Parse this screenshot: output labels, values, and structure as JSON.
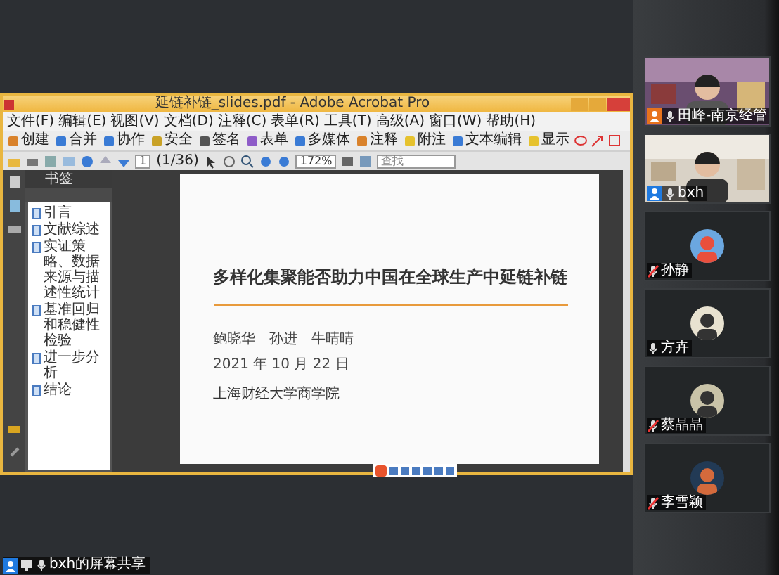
{
  "window": {
    "title": "延链补链_slides.pdf - Adobe Acrobat Pro"
  },
  "menu": [
    "文件(F)",
    "编辑(E)",
    "视图(V)",
    "文档(D)",
    "注释(C)",
    "表单(R)",
    "工具(T)",
    "高级(A)",
    "窗口(W)",
    "帮助(H)"
  ],
  "toolbar": [
    {
      "label": "创建",
      "color": "#d9822b"
    },
    {
      "label": "合并",
      "color": "#3a7bd5"
    },
    {
      "label": "协作",
      "color": "#3a7bd5"
    },
    {
      "label": "安全",
      "color": "#c9a227"
    },
    {
      "label": "签名",
      "color": "#555555"
    },
    {
      "label": "表单",
      "color": "#8e5cc8"
    },
    {
      "label": "多媒体",
      "color": "#3a7bd5"
    },
    {
      "label": "注释",
      "color": "#d9822b"
    },
    {
      "label": "附注",
      "color": "#e6c22e"
    },
    {
      "label": "文本编辑",
      "color": "#3a7bd5"
    },
    {
      "label": "显示",
      "color": "#e6c22e"
    }
  ],
  "navigation": {
    "page": "1",
    "page_count": "(1/36)",
    "zoom": "172%",
    "search_placeholder": "查找"
  },
  "bookmarks": {
    "title": "书签",
    "items": [
      "引言",
      "文献综述",
      "实证策略、数据来源与描述性统计",
      "基准回归和稳健性检验",
      "进一步分析",
      "结论"
    ]
  },
  "slide": {
    "title": "多样化集聚能否助力中国在全球生产中延链补链",
    "authors": [
      "鲍晓华",
      "孙进",
      "牛晴晴"
    ],
    "date": "2021 年 10 月 22 日",
    "institution": "上海财经大学商学院"
  },
  "participants": [
    {
      "name": "田峰-南京经管",
      "kind": "video",
      "muted": false,
      "color": "#e8731c"
    },
    {
      "name": "bxh",
      "kind": "video",
      "muted": false,
      "color": "#1f7ae0"
    },
    {
      "name": "孙静",
      "kind": "avatar",
      "muted": true
    },
    {
      "name": "方卉",
      "kind": "avatar",
      "muted": false
    },
    {
      "name": "蔡晶晶",
      "kind": "avatar",
      "muted": true
    },
    {
      "name": "李雪颖",
      "kind": "avatar",
      "muted": true
    }
  ],
  "screen_share": {
    "label": "bxh的屏幕共享"
  }
}
